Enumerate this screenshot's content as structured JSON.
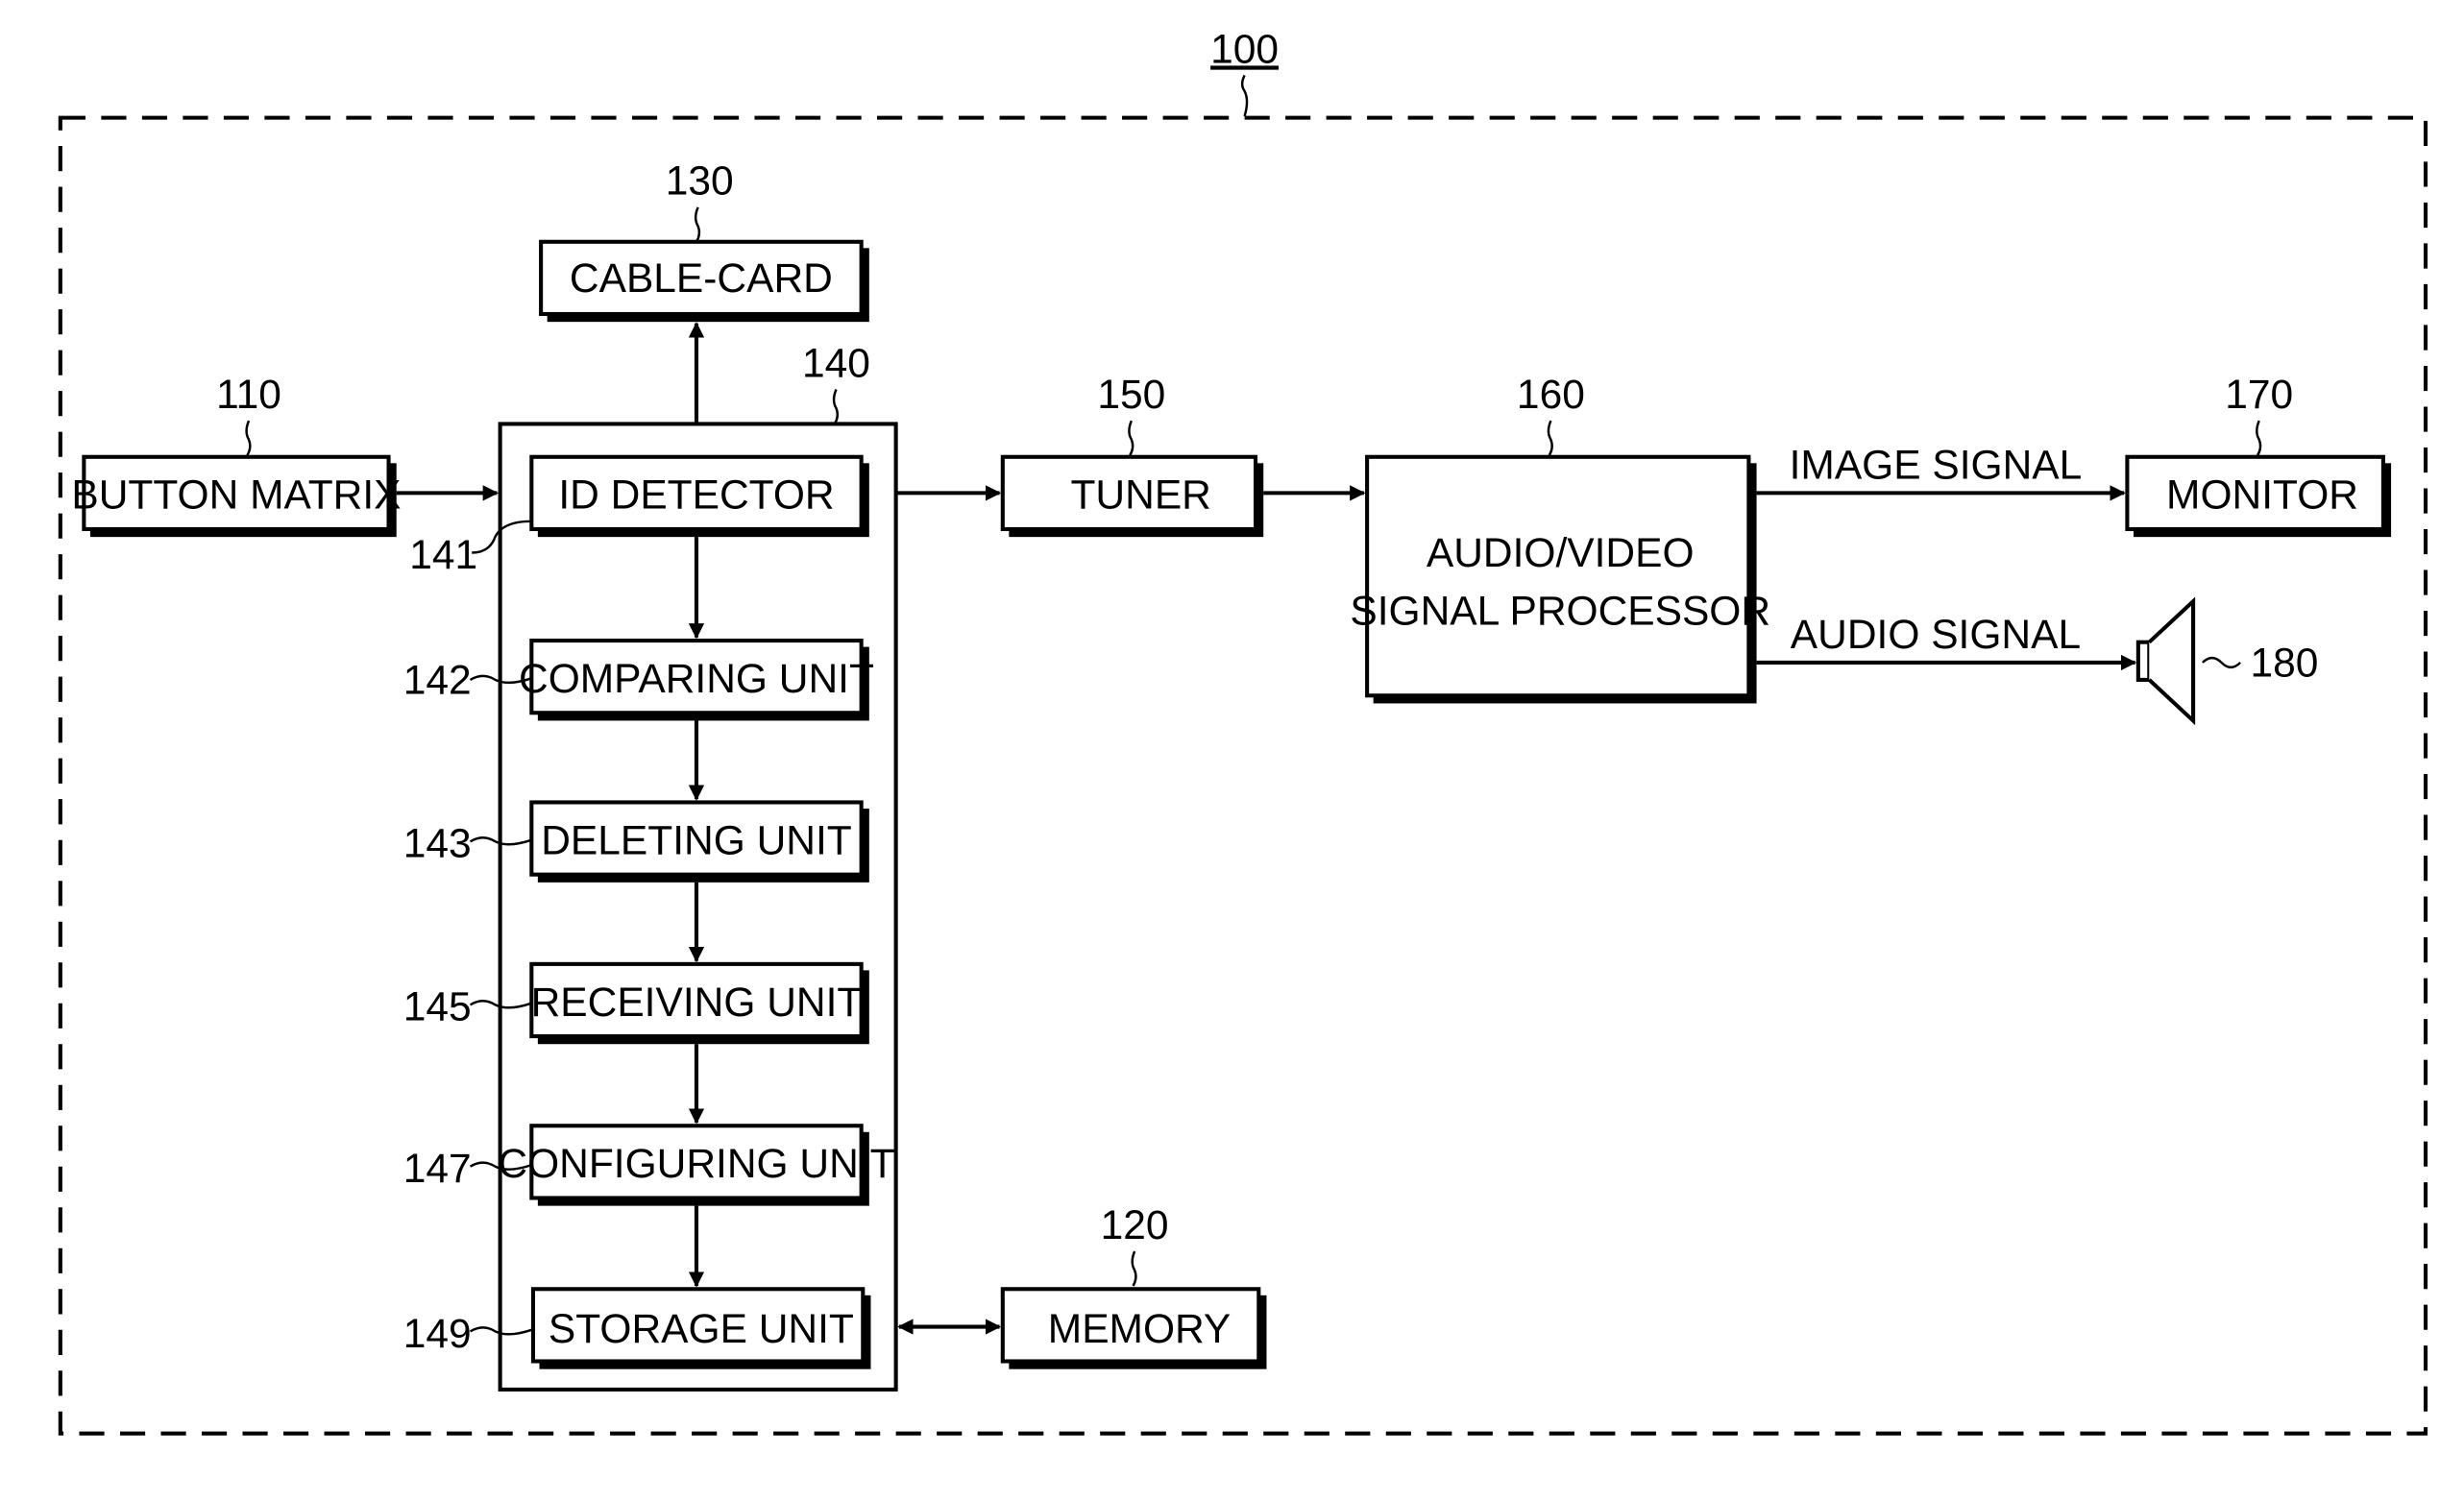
{
  "diagram": {
    "system_ref": "100",
    "blocks": {
      "button_matrix": {
        "ref": "110",
        "label": "BUTTON MATRIX"
      },
      "memory": {
        "ref": "120",
        "label": "MEMORY"
      },
      "cable_card": {
        "ref": "130",
        "label": "CABLE-CARD"
      },
      "controller": {
        "ref": "140"
      },
      "id_detector": {
        "ref": "141",
        "label": "ID DETECTOR"
      },
      "comparing_unit": {
        "ref": "142",
        "label": "COMPARING UNIT"
      },
      "deleting_unit": {
        "ref": "143",
        "label": "DELETING UNIT"
      },
      "receiving_unit": {
        "ref": "145",
        "label": "RECEIVING UNIT"
      },
      "configuring_unit": {
        "ref": "147",
        "label": "CONFIGURING UNIT"
      },
      "storage_unit": {
        "ref": "149",
        "label": "STORAGE UNIT"
      },
      "tuner": {
        "ref": "150",
        "label": "TUNER"
      },
      "av_processor": {
        "ref": "160",
        "label_line1": "AUDIO/VIDEO",
        "label_line2": "SIGNAL PROCESSOR"
      },
      "monitor": {
        "ref": "170",
        "label": "MONITOR"
      },
      "speaker": {
        "ref": "180"
      }
    },
    "signals": {
      "image": "IMAGE SIGNAL",
      "audio": "AUDIO SIGNAL"
    }
  }
}
